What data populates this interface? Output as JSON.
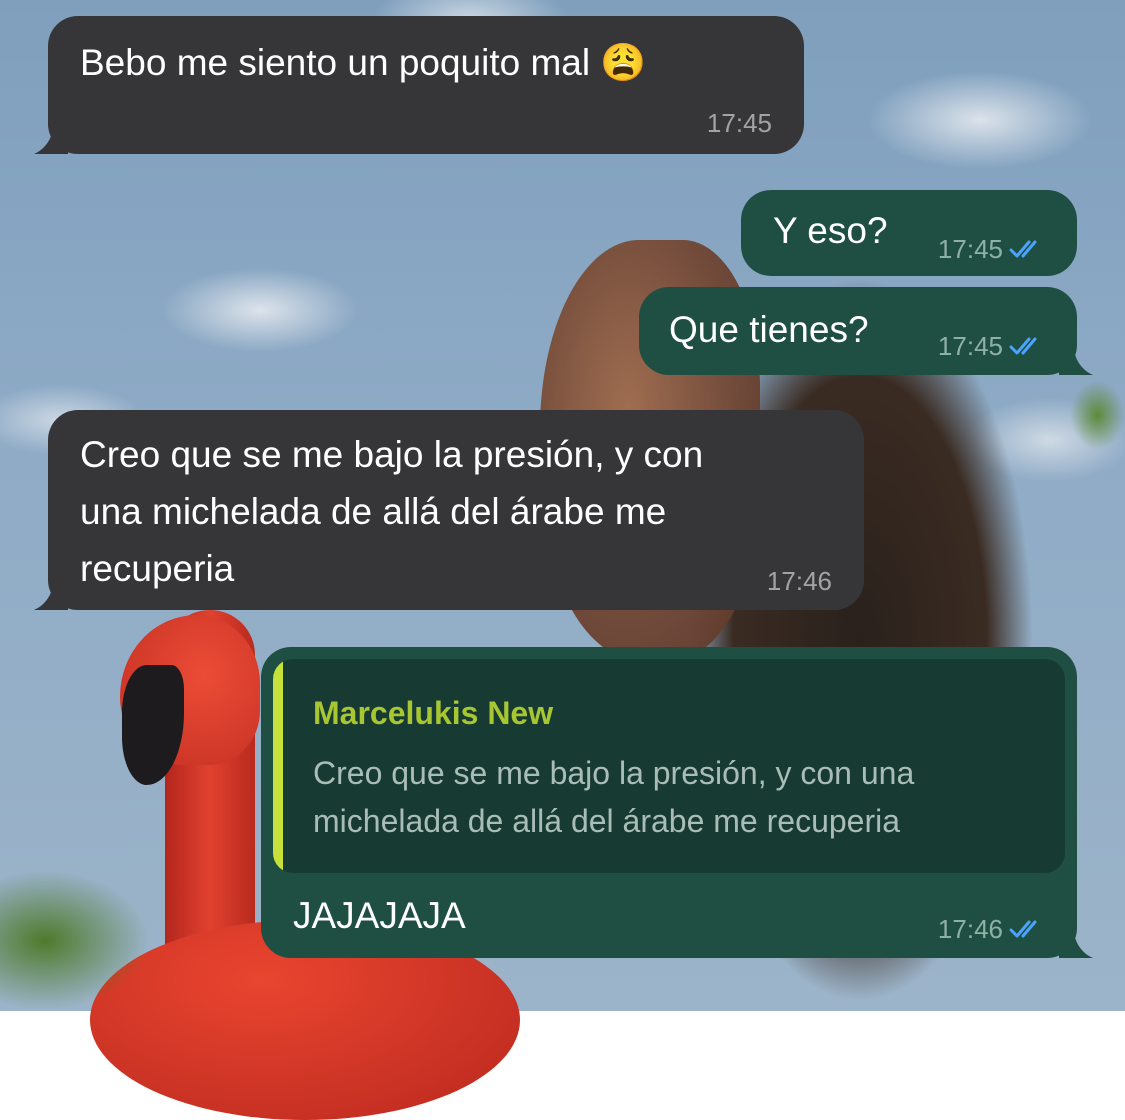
{
  "messages": [
    {
      "direction": "incoming",
      "text": "Bebo me siento un poquito mal 😩",
      "time": "17:45"
    },
    {
      "direction": "outgoing",
      "text": "Y eso?",
      "time": "17:45",
      "status": "read"
    },
    {
      "direction": "outgoing",
      "text": "Que tienes?",
      "time": "17:45",
      "status": "read"
    },
    {
      "direction": "incoming",
      "text": "Creo que se me bajo la presión, y con\nuna michelada de allá del árabe me\nrecuperia",
      "time": "17:46"
    },
    {
      "direction": "outgoing",
      "reply_to": {
        "author": "Marcelukis New",
        "text": "Creo que se me bajo la presión, y con una michelada de allá del árabe me recuperia"
      },
      "text": "JAJAJAJA",
      "time": "17:46",
      "status": "read"
    }
  ],
  "colors": {
    "incoming_bubble": "#363638",
    "outgoing_bubble": "#1f4f43",
    "quote_background": "#173b33",
    "quote_accent": "#c5e13a",
    "quote_author": "#a7c631",
    "read_ticks": "#4aa3ff"
  },
  "icons": {
    "read_receipt": "double-check-icon"
  }
}
